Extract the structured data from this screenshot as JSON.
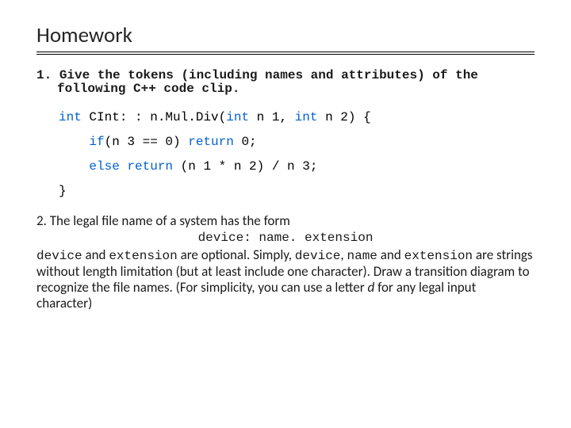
{
  "title": "Homework",
  "q1": {
    "num": "1.",
    "line1": "Give the tokens (including names and attributes) of the",
    "line2": "following C++ code clip.",
    "code": {
      "l1_a": "int",
      "l1_b": " CInt: : n.Mul.Div(",
      "l1_c": "int",
      "l1_d": " n 1, ",
      "l1_e": "int",
      "l1_f": " n 2) {",
      "l2_a": "if",
      "l2_b": "(n 3 == 0) ",
      "l2_c": "return",
      "l2_d": " 0;",
      "l3_a": "else",
      "l3_b": " ",
      "l3_c": "return",
      "l3_d": " (n 1 * n 2) / n 3;",
      "l4": "}"
    }
  },
  "q2": {
    "line1": "2. The legal file name of a system has the form",
    "form": "device: name. extension",
    "body_a": "device",
    "body_b": " and ",
    "body_c": "extension",
    "body_d": " are optional. Simply, ",
    "body_e": "device",
    "body_f": ", ",
    "body_g": "name",
    "body_h": " and ",
    "body_i": "extension",
    "body_j": " are strings without length limitation (but at least include one character). Draw a transition diagram to recognize the file names. (For simplicity, you can use a letter ",
    "body_k": "d",
    "body_l": " for any legal input character)"
  }
}
